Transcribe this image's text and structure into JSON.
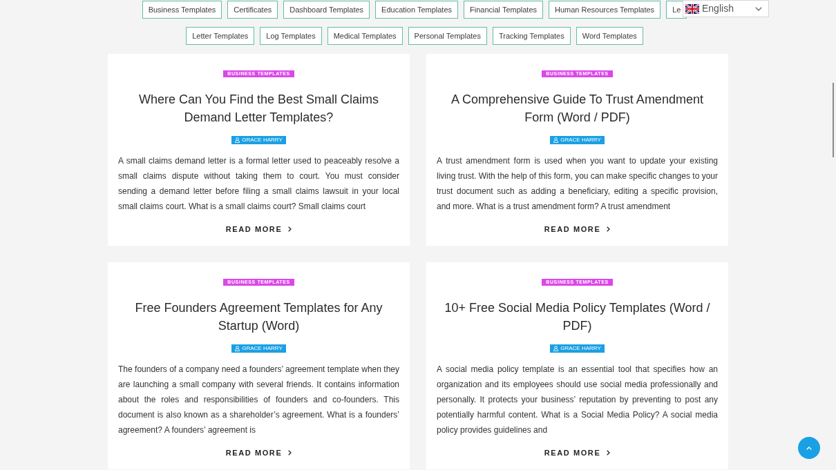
{
  "category_link_rows": [
    [
      "Business Templates",
      "Certificates",
      "Dashboard Templates",
      "Education Templates",
      "Financial Templates",
      "Human Resources Templates",
      "Le"
    ],
    [
      "Letter Templates",
      "Log Templates",
      "Medical Templates",
      "Personal Templates",
      "Tracking Templates",
      "Word Templates"
    ]
  ],
  "language_selector": {
    "value": "English"
  },
  "posts": [
    {
      "category": "BUSINESS TEMPLATES",
      "title": "Where Can You Find the Best Small Claims Demand Letter Templates?",
      "author": "GRACE HARRY",
      "excerpt": "A small claims demand letter is a formal letter used to peaceably resolve a small claims dispute without taking them to court. You must consider sending a demand letter before filing a small claims lawsuit in your local small claims court. What is a small claims court? Small claims court",
      "read_more": "READ MORE"
    },
    {
      "category": "BUSINESS TEMPLATES",
      "title": "A Comprehensive Guide To Trust Amendment Form (Word / PDF)",
      "author": "GRACE HARRY",
      "excerpt": "A trust amendment form is used when you want to update your existing living trust. With the help of this form, you can make specific changes to your trust document such as adding a beneficiary, editing a specific provision, and more. What is a trust amendment form? A trust amendment",
      "read_more": "READ MORE"
    },
    {
      "category": "BUSINESS TEMPLATES",
      "title": "Free Founders Agreement Templates for Any Startup (Word)",
      "author": "GRACE HARRY",
      "excerpt": "The founders of a company need a founders’ agreement template when they are launching a small company with several friends. It contains information about the roles and responsibilities of founders and co-founders. This document is also known as a shareholder’s agreement. What is a founders’ agreement? A founders’ agreement is",
      "read_more": "READ MORE"
    },
    {
      "category": "BUSINESS TEMPLATES",
      "title": "10+ Free Social Media Policy Templates (Word / PDF)",
      "author": "GRACE HARRY",
      "excerpt": "A social media policy template is an essential tool that specifies how an organization and its employees should use social media professionally and personally. It protects your business’ reputation by preventing to post any potentially harmful content. What is a Social Media Policy? A social media policy provides guidelines and",
      "read_more": "READ MORE"
    }
  ]
}
